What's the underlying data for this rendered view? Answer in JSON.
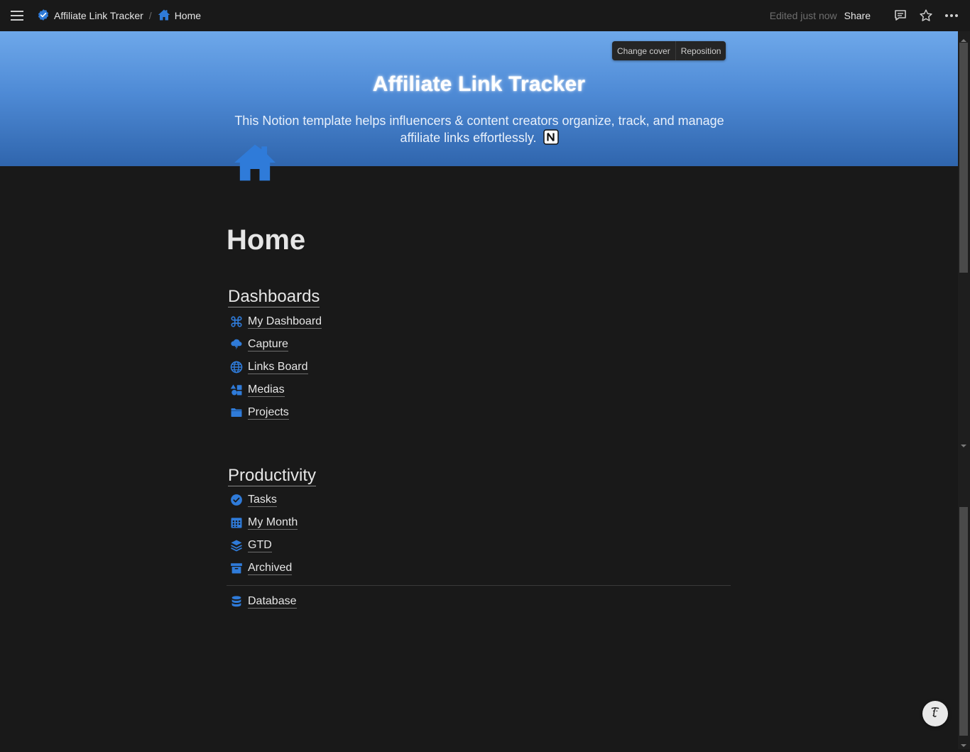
{
  "topbar": {
    "breadcrumb": [
      {
        "label": "Affiliate Link Tracker",
        "icon": "check-badge-icon"
      },
      {
        "label": "Home",
        "icon": "home-icon"
      }
    ],
    "separator": "/",
    "edited": "Edited just now",
    "share": "Share"
  },
  "cover": {
    "change_cover": "Change cover",
    "reposition": "Reposition",
    "title": "Affiliate Link Tracker",
    "description": "This Notion template helps influencers & content creators organize, track, and manage affiliate links effortlessly."
  },
  "page": {
    "title": "Home",
    "sections": [
      {
        "heading": "Dashboards",
        "links": [
          {
            "label": "My Dashboard",
            "icon": "command-icon"
          },
          {
            "label": "Capture",
            "icon": "cloud-bolt-icon"
          },
          {
            "label": "Links Board",
            "icon": "globe-icon"
          },
          {
            "label": "Medias",
            "icon": "shapes-icon"
          },
          {
            "label": "Projects",
            "icon": "folder-icon"
          }
        ]
      },
      {
        "heading": "Productivity",
        "links": [
          {
            "label": "Tasks",
            "icon": "check-circle-icon"
          },
          {
            "label": "My Month",
            "icon": "calendar-icon"
          },
          {
            "label": "GTD",
            "icon": "layers-icon"
          },
          {
            "label": "Archived",
            "icon": "archive-icon"
          }
        ]
      }
    ],
    "database_link": {
      "label": "Database",
      "icon": "database-icon"
    }
  },
  "colors": {
    "accent": "#2f7bd9",
    "background": "#191919",
    "text": "#e6e6e6"
  }
}
